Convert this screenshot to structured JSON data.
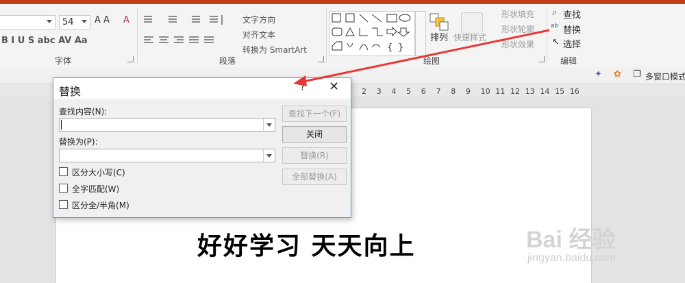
{
  "ribbon": {
    "font_group_label": "字体",
    "paragraph_group_label": "段落",
    "drawing_group_label": "绘图",
    "editing_group_label": "编辑",
    "font_size": "54",
    "text_direction": "文字方向",
    "align_text": "对齐文本",
    "convert_smartart": "转换为 SmartArt",
    "arrange": "排列",
    "quick_styles": "快速样式",
    "shape_fill": "形状填充",
    "shape_outline": "形状轮廓",
    "shape_effects": "形状效果",
    "find": "查找",
    "replace": "替换",
    "select": "选择",
    "font_format_text": "B  I  U  S  abc  AV  Aa",
    "grow_shrink_text": "A A",
    "clear_format": "A"
  },
  "toolstrip": {
    "multi_window": "多窗口模式"
  },
  "ruler": {
    "ticks": [
      "2",
      "3",
      "4",
      "5",
      "6",
      "7",
      "8",
      "9",
      "10",
      "11",
      "12",
      "13",
      "14",
      "15",
      "16"
    ]
  },
  "dialog": {
    "title": "替换",
    "help": "?",
    "close": "✕",
    "find_label": "查找内容(N):",
    "find_value": "",
    "replace_label": "替换为(P):",
    "replace_value": "",
    "match_case": "区分大小写(C)",
    "whole_word": "全字匹配(W)",
    "match_width": "区分全/半角(M)",
    "btn_find_next": "查找下一个(F)",
    "btn_close": "关闭",
    "btn_replace": "替换(R)",
    "btn_replace_all": "全部替换(A)"
  },
  "slide": {
    "text": "好好学习 天天向上"
  },
  "watermark": {
    "brand": "Bai 经验",
    "url": "jingyan.baidu.com"
  },
  "colors": {
    "title_bar": "#c43e1c",
    "arrow": "#e53935",
    "dialog_border": "#5b9bd5"
  }
}
